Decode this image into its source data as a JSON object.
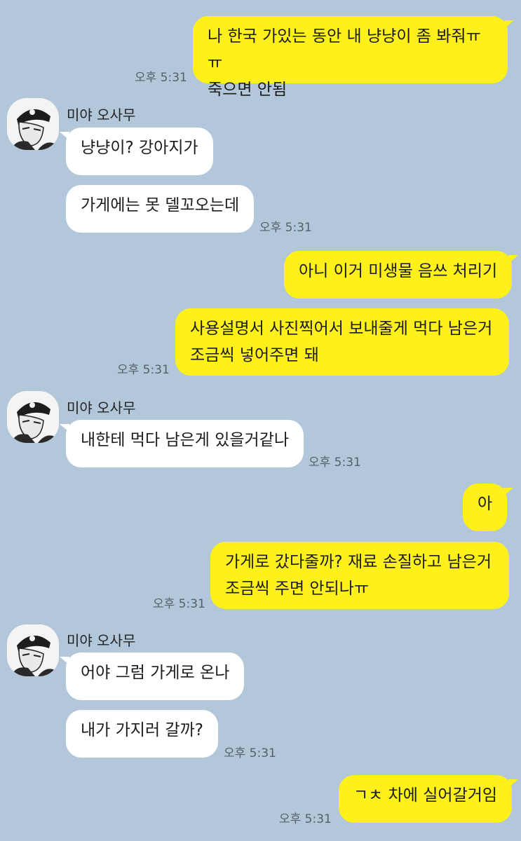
{
  "contact": {
    "name": "미야 오사무"
  },
  "messages": [
    {
      "text": "나 한국 가있는 동안 내 냥냥이 좀 봐줘ㅠㅠ\n죽으면 안됨",
      "time": "오후 5:31"
    },
    {
      "text": "냥냥이? 강아지가"
    },
    {
      "text": "가게에는 못 델꼬오는데",
      "time": "오후 5:31"
    },
    {
      "text": "아니 이거 미생물 음쓰 처리기"
    },
    {
      "text": "사용설명서 사진찍어서 보내줄게 먹다 남은거\n조금씩 넣어주면 돼",
      "time": "오후 5:31"
    },
    {
      "text": "내한테 먹다 남은게 있을거같나",
      "time": "오후 5:31"
    },
    {
      "text": "아"
    },
    {
      "text": "가게로 갔다줄까? 재료 손질하고 남은거\n조금씩 주면 안되나ㅠ",
      "time": "오후 5:31"
    },
    {
      "text": "어야 그럼 가게로 온나"
    },
    {
      "text": "내가 가지러 갈까?",
      "time": "오후 5:31"
    },
    {
      "text": "ㄱㅊ 차에 실어갈거임",
      "time": "오후 5:31"
    }
  ],
  "colors": {
    "background": "#b2c7da",
    "outgoing_bubble": "#fef01b",
    "incoming_bubble": "#ffffff"
  },
  "icons": {
    "avatar": "avatar-icon"
  }
}
